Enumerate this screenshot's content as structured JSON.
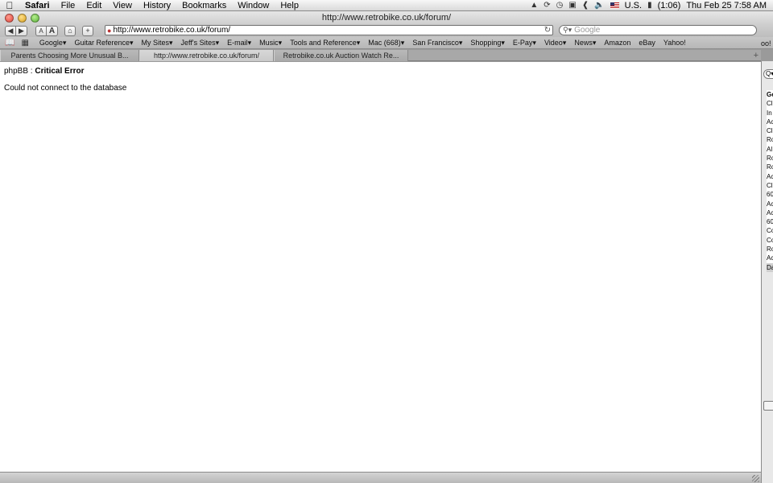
{
  "menubar": {
    "app": "Safari",
    "items": [
      "File",
      "Edit",
      "View",
      "History",
      "Bookmarks",
      "Window",
      "Help"
    ],
    "status": {
      "battery": "(1:06)",
      "input_source": "U.S.",
      "clock": "Thu Feb 25  7:58 AM"
    }
  },
  "window": {
    "title": "http://www.retrobike.co.uk/forum/"
  },
  "toolbar": {
    "back_label": "◀",
    "forward_label": "▶",
    "text_smaller_label": "A",
    "text_bigger_label": "A",
    "home_label": "⌂",
    "add_label": "+",
    "url": "http://www.retrobike.co.uk/forum/",
    "search_placeholder": "Google"
  },
  "bookmarks": {
    "items": [
      "Google▾",
      "Guitar Reference▾",
      "My Sites▾",
      "Jeff's Sites▾",
      "E-mail▾",
      "Music▾",
      "Tools and Reference▾",
      "Mac (668)▾",
      "San Francisco▾",
      "Shopping▾",
      "E-Pay▾",
      "Video▾",
      "News▾",
      "Amazon",
      "eBay",
      "Yahoo!"
    ],
    "overflow": "oo!"
  },
  "tabs": [
    {
      "label": "Parents Choosing More Unusual B..."
    },
    {
      "label": "http://www.retrobike.co.uk/forum/"
    },
    {
      "label": "Retrobike.co.uk Auction Watch Re..."
    }
  ],
  "page": {
    "heading_prefix": "phpBB : ",
    "heading_bold": "Critical Error",
    "message": "Could not connect to the database"
  },
  "background_window": {
    "list": [
      "Ge",
      "Cl",
      "In",
      "Ac",
      "Cl",
      "Ro",
      "Al",
      "Ro",
      "Ro",
      "Ac",
      "Cl",
      "60",
      "Ac",
      "Ac",
      "60",
      "Co",
      "Co",
      "Ro",
      "Ac",
      "Da"
    ],
    "search_glyph": "Q▾"
  },
  "colors": {
    "address_border": "#6f6f6f",
    "page_background": "#ffffff",
    "chrome_gray": "#bdbdbd"
  }
}
